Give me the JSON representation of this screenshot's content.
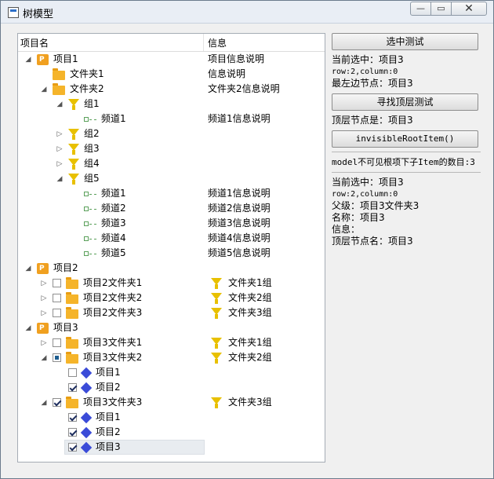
{
  "window": {
    "title": "树模型"
  },
  "tree": {
    "headers": [
      "项目名",
      "信息"
    ],
    "rows": [
      {
        "level": 0,
        "expander": "open",
        "check": null,
        "icon": "project",
        "label": "项目1",
        "info": "项目信息说明",
        "info_icon": null
      },
      {
        "level": 1,
        "expander": "none",
        "check": null,
        "icon": "folder",
        "label": "文件夹1",
        "info": "信息说明",
        "info_icon": null
      },
      {
        "level": 1,
        "expander": "open",
        "check": null,
        "icon": "folder",
        "label": "文件夹2",
        "info": "文件夹2信息说明",
        "info_icon": null
      },
      {
        "level": 2,
        "expander": "open",
        "check": null,
        "icon": "funnel",
        "label": "组1",
        "info": "",
        "info_icon": null
      },
      {
        "level": 3,
        "expander": "none",
        "check": null,
        "icon": "channel",
        "label": "频道1",
        "info": "频道1信息说明",
        "info_icon": null
      },
      {
        "level": 2,
        "expander": "closed",
        "check": null,
        "icon": "funnel",
        "label": "组2",
        "info": "",
        "info_icon": null
      },
      {
        "level": 2,
        "expander": "closed",
        "check": null,
        "icon": "funnel",
        "label": "组3",
        "info": "",
        "info_icon": null
      },
      {
        "level": 2,
        "expander": "closed",
        "check": null,
        "icon": "funnel",
        "label": "组4",
        "info": "",
        "info_icon": null
      },
      {
        "level": 2,
        "expander": "open",
        "check": null,
        "icon": "funnel",
        "label": "组5",
        "info": "",
        "info_icon": null
      },
      {
        "level": 3,
        "expander": "none",
        "check": null,
        "icon": "channel",
        "label": "频道1",
        "info": "频道1信息说明",
        "info_icon": null
      },
      {
        "level": 3,
        "expander": "none",
        "check": null,
        "icon": "channel",
        "label": "频道2",
        "info": "频道2信息说明",
        "info_icon": null
      },
      {
        "level": 3,
        "expander": "none",
        "check": null,
        "icon": "channel",
        "label": "频道3",
        "info": "频道3信息说明",
        "info_icon": null
      },
      {
        "level": 3,
        "expander": "none",
        "check": null,
        "icon": "channel",
        "label": "频道4",
        "info": "频道4信息说明",
        "info_icon": null
      },
      {
        "level": 3,
        "expander": "none",
        "check": null,
        "icon": "channel",
        "label": "频道5",
        "info": "频道5信息说明",
        "info_icon": null
      },
      {
        "level": 0,
        "expander": "open",
        "check": null,
        "icon": "project",
        "label": "项目2",
        "info": "",
        "info_icon": null
      },
      {
        "level": 1,
        "expander": "closed",
        "check": "unchecked",
        "icon": "folder",
        "label": "项目2文件夹1",
        "info": "文件夹1组",
        "info_icon": "funnel"
      },
      {
        "level": 1,
        "expander": "closed",
        "check": "unchecked",
        "icon": "folder",
        "label": "项目2文件夹2",
        "info": "文件夹2组",
        "info_icon": "funnel"
      },
      {
        "level": 1,
        "expander": "closed",
        "check": "unchecked",
        "icon": "folder",
        "label": "项目2文件夹3",
        "info": "文件夹3组",
        "info_icon": "funnel"
      },
      {
        "level": 0,
        "expander": "open",
        "check": null,
        "icon": "project",
        "label": "项目3",
        "info": "",
        "info_icon": null
      },
      {
        "level": 1,
        "expander": "closed",
        "check": "unchecked",
        "icon": "folder",
        "label": "项目3文件夹1",
        "info": "文件夹1组",
        "info_icon": "funnel"
      },
      {
        "level": 1,
        "expander": "open",
        "check": "partial",
        "icon": "folder",
        "label": "项目3文件夹2",
        "info": "文件夹2组",
        "info_icon": "funnel"
      },
      {
        "level": 2,
        "expander": "none",
        "check": "unchecked",
        "icon": "cube",
        "label": "项目1",
        "info": "",
        "info_icon": null
      },
      {
        "level": 2,
        "expander": "none",
        "check": "checked",
        "icon": "cube",
        "label": "项目2",
        "info": "",
        "info_icon": null
      },
      {
        "level": 1,
        "expander": "open",
        "check": "checked",
        "icon": "folder",
        "label": "项目3文件夹3",
        "info": "文件夹3组",
        "info_icon": "funnel"
      },
      {
        "level": 2,
        "expander": "none",
        "check": "checked",
        "icon": "cube",
        "label": "项目1",
        "info": "",
        "info_icon": null
      },
      {
        "level": 2,
        "expander": "none",
        "check": "checked",
        "icon": "cube",
        "label": "项目2",
        "info": "",
        "info_icon": null
      },
      {
        "level": 2,
        "expander": "none",
        "check": "checked",
        "icon": "cube",
        "label": "项目3",
        "info": "",
        "info_icon": null,
        "selected": true
      }
    ]
  },
  "panel": {
    "select_button": "选中测试",
    "current_selected": "当前选中：项目3",
    "row_col": "row:2,column:0",
    "leftmost": "最左边节点：项目3",
    "find_top_button": "寻找顶层测试",
    "top_node": "顶层节点是：项目3",
    "invisible_root_button": "invisibleRootItem()",
    "model_count": "model不可见根项下子Item的数目:3",
    "detail_selected": "当前选中：项目3",
    "detail_row_col": "row:2,column:0",
    "parent": "父级：项目3文件夹3",
    "name": "名称：项目3",
    "info": "信息：",
    "top_name": "顶层节点名：项目3"
  }
}
